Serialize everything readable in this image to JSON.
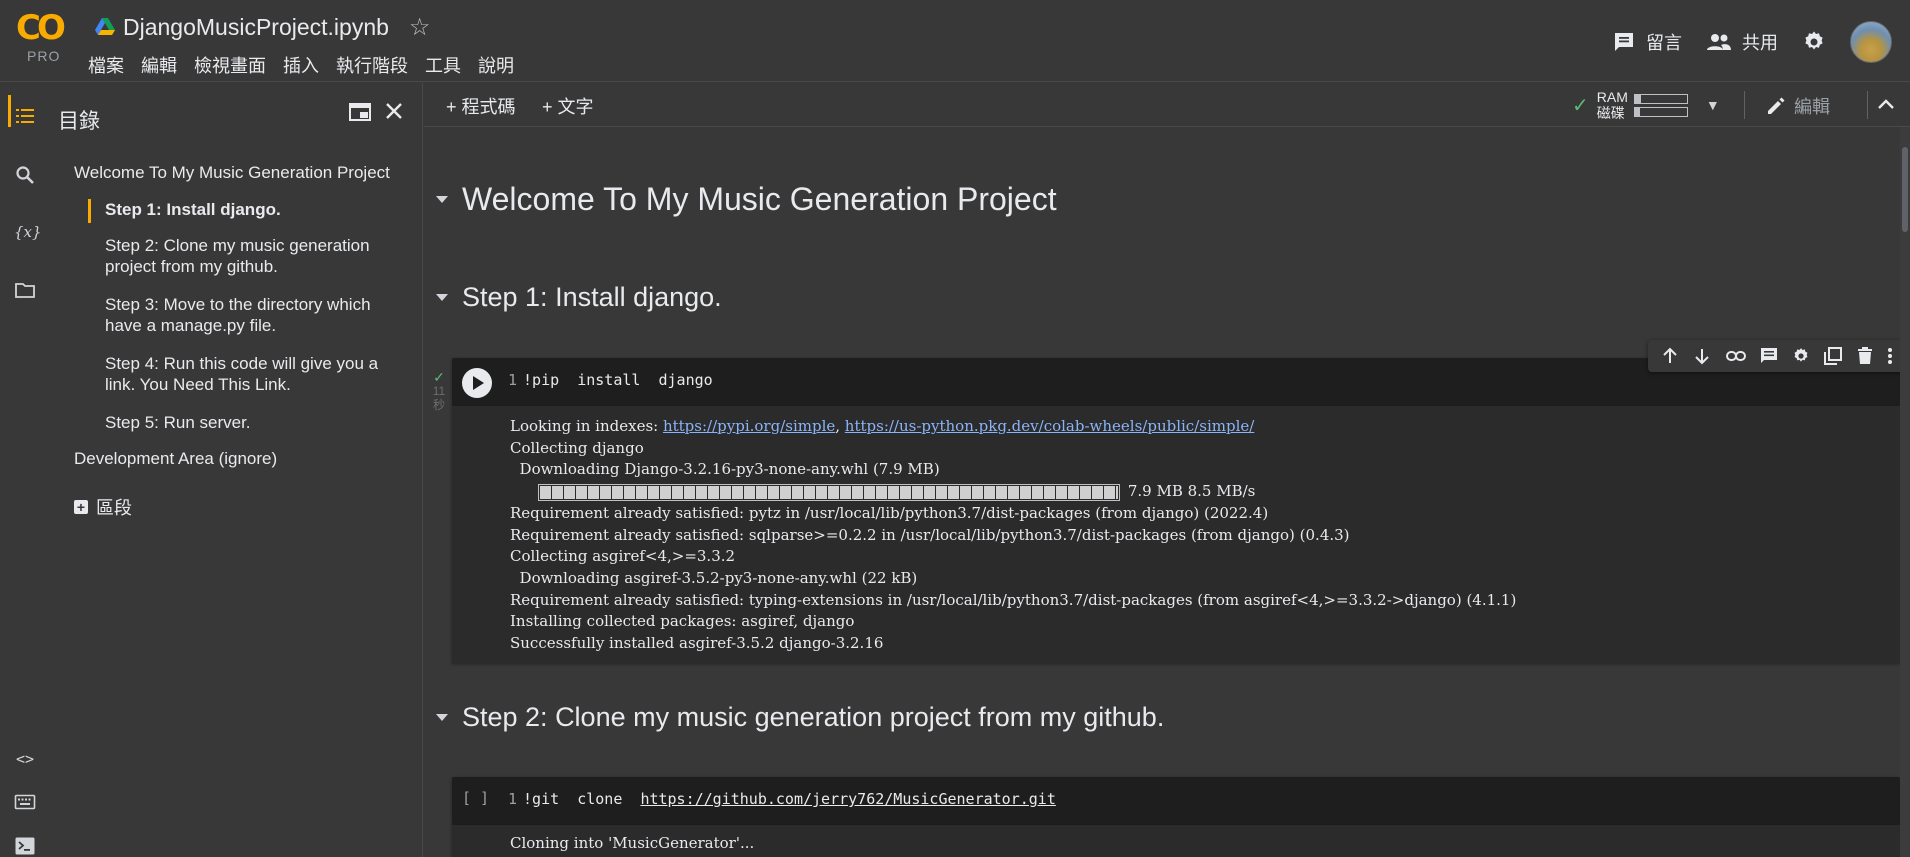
{
  "header": {
    "logo_text": "CO",
    "logo_badge": "PRO",
    "notebook_title": "DjangoMusicProject.ipynb",
    "menu": [
      "檔案",
      "編輯",
      "檢視畫面",
      "插入",
      "執行階段",
      "工具",
      "說明"
    ],
    "comment_label": "留言",
    "share_label": "共用"
  },
  "toc": {
    "title": "目錄",
    "items": [
      {
        "label": "Welcome To My Music Generation Project"
      },
      {
        "label": "Step 1: Install django."
      },
      {
        "label": "Step 2: Clone my music generation project from my github."
      },
      {
        "label": "Step 3: Move to the directory which have a manage.py file."
      },
      {
        "label": "Step 4: Run this code will give you a link. You Need This Link."
      },
      {
        "label": "Step 5: Run server."
      },
      {
        "label": "Development Area (ignore)"
      }
    ],
    "add_section_label": "區段"
  },
  "toolbar": {
    "add_code_label": "+ 程式碼",
    "add_text_label": "+ 文字",
    "ram_label": "RAM",
    "disk_label": "磁碟",
    "edit_label": "編輯"
  },
  "notebook": {
    "h1": "Welcome To My Music Generation Project",
    "step1_heading": "Step 1: Install django.",
    "cell1": {
      "exec_time": "11\n秒",
      "line_no": "1",
      "code_cmd": "!pip  install  django",
      "output_prefix": "Looking in indexes: ",
      "output_link1": "https://pypi.org/simple",
      "output_sep": ", ",
      "output_link2": "https://us-python.pkg.dev/colab-wheels/public/simple/",
      "output_lines_a": "Collecting django\n  Downloading Django-3.2.16-py3-none-any.whl (7.9 MB)",
      "progress_text": "7.9 MB 8.5 MB/s",
      "output_lines_b": "Requirement already satisfied: pytz in /usr/local/lib/python3.7/dist-packages (from django) (2022.4)\nRequirement already satisfied: sqlparse>=0.2.2 in /usr/local/lib/python3.7/dist-packages (from django) (0.4.3)\nCollecting asgiref<4,>=3.3.2\n  Downloading asgiref-3.5.2-py3-none-any.whl (22 kB)\nRequirement already satisfied: typing-extensions in /usr/local/lib/python3.7/dist-packages (from asgiref<4,>=3.3.2->django) (4.1.1)\nInstalling collected packages: asgiref, django\nSuccessfully installed asgiref-3.5.2 django-3.2.16"
    },
    "step2_heading": "Step 2: Clone my music generation project from my github.",
    "cell2": {
      "brackets": "[ ]",
      "line_no": "1",
      "code_cmd": "!git  clone  ",
      "code_link": "https://github.com/jerry762/MusicGenerator.git",
      "output": "Cloning into 'MusicGenerator'..."
    }
  },
  "resources": {
    "ram_fraction": 0.12,
    "disk_fraction": 0.1
  },
  "colors": {
    "accent": "#f9ab00",
    "background": "#383838",
    "code_bg": "#1e1e1e",
    "link": "#8ab4f8",
    "ok_green": "#5bb974"
  }
}
